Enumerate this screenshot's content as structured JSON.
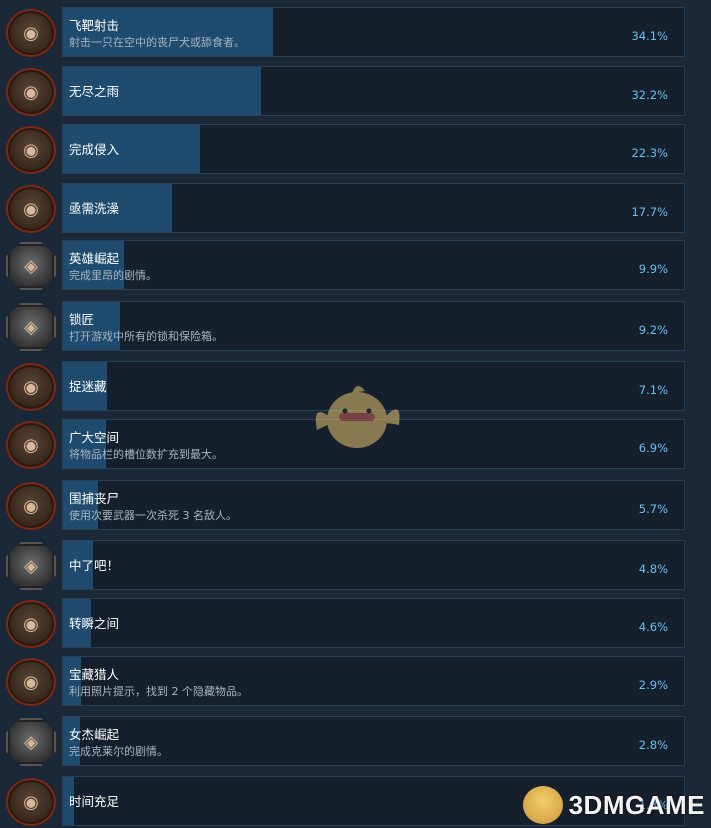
{
  "achievements": [
    {
      "title": "飞靶射击",
      "desc": "射击一只在空中的丧尸犬或舔食者。",
      "pct": "34.1%",
      "fill": 0.341,
      "icon": "red-frame-icon"
    },
    {
      "title": "无尽之雨",
      "desc": "",
      "pct": "32.2%",
      "fill": 0.322,
      "icon": "red-frame-icon"
    },
    {
      "title": "完成侵入",
      "desc": "",
      "pct": "22.3%",
      "fill": 0.223,
      "icon": "red-frame-icon"
    },
    {
      "title": "亟需洗澡",
      "desc": "",
      "pct": "17.7%",
      "fill": 0.177,
      "icon": "red-frame-icon"
    },
    {
      "title": "英雄崛起",
      "desc": "完成里昂的剧情。",
      "pct": "9.9%",
      "fill": 0.099,
      "icon": "grey-frame-icon"
    },
    {
      "title": "锁匠",
      "desc": "打开游戏中所有的锁和保险箱。",
      "pct": "9.2%",
      "fill": 0.092,
      "icon": "grey-frame-icon"
    },
    {
      "title": "捉迷藏",
      "desc": "",
      "pct": "7.1%",
      "fill": 0.071,
      "icon": "red-frame-icon"
    },
    {
      "title": "广大空间",
      "desc": "将物品栏的槽位数扩充到最大。",
      "pct": "6.9%",
      "fill": 0.069,
      "icon": "red-frame-icon"
    },
    {
      "title": "围捕丧尸",
      "desc": "使用次要武器一次杀死 3 名敌人。",
      "pct": "5.7%",
      "fill": 0.057,
      "icon": "red-frame-icon"
    },
    {
      "title": "中了吧！",
      "desc": "",
      "pct": "4.8%",
      "fill": 0.048,
      "icon": "grey-frame-icon"
    },
    {
      "title": "转瞬之间",
      "desc": "",
      "pct": "4.6%",
      "fill": 0.046,
      "icon": "red-frame-icon"
    },
    {
      "title": "宝藏猎人",
      "desc": "利用照片提示，找到 2 个隐藏物品。",
      "pct": "2.9%",
      "fill": 0.029,
      "icon": "red-frame-icon"
    },
    {
      "title": "女杰崛起",
      "desc": "完成克莱尔的剧情。",
      "pct": "2.8%",
      "fill": 0.028,
      "icon": "grey-frame-icon"
    },
    {
      "title": "时间充足",
      "desc": "",
      "pct": "1.8%",
      "fill": 0.018,
      "icon": "red-frame-icon"
    }
  ],
  "watermark": {
    "text": "3DMGAME"
  },
  "colors": {
    "bg": "#1b2838",
    "bar_fill": "#1e4b6e",
    "pct_text": "#66c0f4"
  }
}
